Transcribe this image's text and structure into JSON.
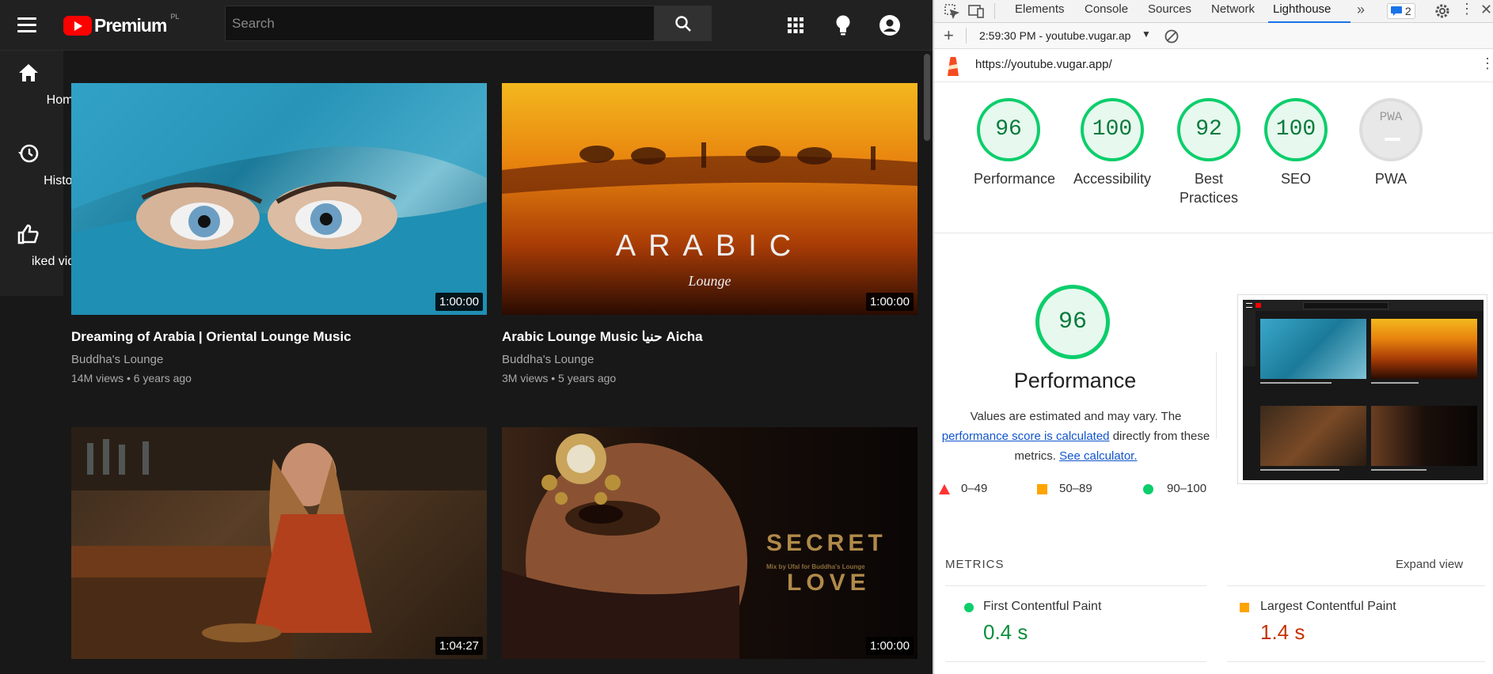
{
  "yt": {
    "logo_word": "Premium",
    "country_code": "PL",
    "search_placeholder": "Search",
    "sidebar": [
      {
        "label": "Home",
        "icon": "home-icon"
      },
      {
        "label": "History",
        "icon": "history-icon"
      },
      {
        "label": "iked videos",
        "icon": "thumbs-up-icon"
      }
    ],
    "videos": [
      {
        "title": "Dreaming of Arabia | Oriental Lounge Music",
        "channel": "Buddha's Lounge",
        "meta": "14M views • 6 years ago",
        "duration": "1:00:00"
      },
      {
        "title": "Arabic Lounge Music حنيا Aicha",
        "channel": "Buddha's Lounge",
        "meta": "3M views • 5 years ago",
        "duration": "1:00:00",
        "thumb_text": "ARABIC",
        "thumb_script": "Lounge"
      },
      {
        "duration": "1:04:27"
      },
      {
        "duration": "1:00:00",
        "thumb_text1": "SECRET",
        "thumb_sub": "Mix by Ufal for Buddha's Lounge",
        "thumb_text2": "LOVE"
      }
    ]
  },
  "devtools": {
    "tabs": [
      "Elements",
      "Console",
      "Sources",
      "Network",
      "Lighthouse"
    ],
    "active_tab": "Lighthouse",
    "issues_count": "2",
    "report_time": "2:59:30 PM - youtube.vugar.ap",
    "url": "https://youtube.vugar.app/",
    "scores": [
      {
        "value": "96",
        "label": "Performance"
      },
      {
        "value": "100",
        "label": "Accessibility"
      },
      {
        "value": "92",
        "label": "Best Practices"
      },
      {
        "value": "100",
        "label": "SEO"
      },
      {
        "value": "PWA",
        "label": "PWA"
      }
    ],
    "perf_score": "96",
    "perf_title": "Performance",
    "perf_note_1": "Values are estimated and may vary. The",
    "perf_link_1": "performance score is calculated",
    "perf_note_2": "directly from these",
    "perf_note_3": "metrics.",
    "perf_link_2": "See calculator.",
    "legend": [
      "0–49",
      "50–89",
      "90–100"
    ],
    "metrics_heading": "METRICS",
    "expand": "Expand view",
    "metrics": [
      {
        "label": "First Contentful Paint",
        "value": "0.4 s",
        "color": "#0a8f3c"
      },
      {
        "label": "Largest Contentful Paint",
        "value": "1.4 s",
        "color": "#c33300"
      }
    ]
  },
  "colors": {
    "good": "#0cce6b",
    "average": "#ffa400",
    "fail": "#ff3333",
    "accent": "#1a73e8"
  }
}
